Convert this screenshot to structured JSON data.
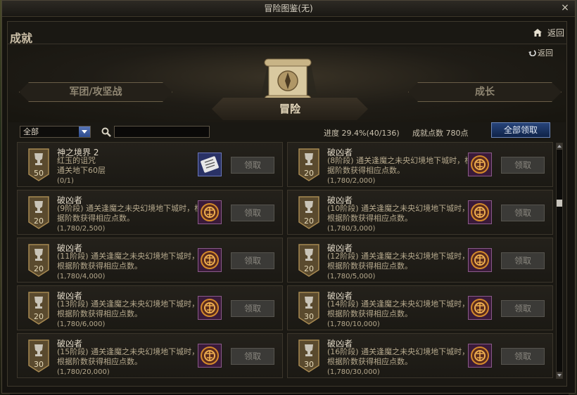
{
  "window": {
    "title": "冒险图鉴(无)",
    "close_label": "×"
  },
  "header": {
    "section_title": "成就",
    "return_label": "返回"
  },
  "sub_return": {
    "label": "返回"
  },
  "tabs": {
    "left": "军团/攻坚战",
    "center": "冒险",
    "right": "成长"
  },
  "filter": {
    "selected": "全部",
    "search_placeholder": ""
  },
  "stats": {
    "progress": "进度 29.4%(40/136)",
    "points": "成就点数 780点"
  },
  "claim_all_label": "全部领取",
  "claim_label": "领取",
  "achievements": [
    {
      "title": "神之境界 2",
      "desc": "红玉的诅咒\n通关地下60层",
      "progress": "(0/1)",
      "points": "50",
      "reward_icon": "scroll-ticket-icon"
    },
    {
      "title": "破凶者",
      "desc": "(8阶段) 通关逢魔之未央幻境地下城时，根据阶数获得相应点数。",
      "progress": "(1,780/2,000)",
      "points": "20",
      "reward_icon": "emblem-icon"
    },
    {
      "title": "破凶者",
      "desc": "(9阶段) 通关逢魔之未央幻境地下城时，根据阶数获得相应点数。",
      "progress": "(1,780/2,500)",
      "points": "20",
      "reward_icon": "emblem-icon"
    },
    {
      "title": "破凶者",
      "desc": "(10阶段) 通关逢魔之未央幻境地下城时，根据阶数获得相应点数。",
      "progress": "(1,780/3,000)",
      "points": "20",
      "reward_icon": "emblem-icon"
    },
    {
      "title": "破凶者",
      "desc": "(11阶段) 通关逢魔之未央幻境地下城时，根据阶数获得相应点数。",
      "progress": "(1,780/4,000)",
      "points": "20",
      "reward_icon": "emblem-icon"
    },
    {
      "title": "破凶者",
      "desc": "(12阶段) 通关逢魔之未央幻境地下城时，根据阶数获得相应点数。",
      "progress": "(1,780/5,000)",
      "points": "20",
      "reward_icon": "emblem-icon"
    },
    {
      "title": "破凶者",
      "desc": "(13阶段) 通关逢魔之未央幻境地下城时，根据阶数获得相应点数。",
      "progress": "(1,780/6,000)",
      "points": "20",
      "reward_icon": "emblem-icon"
    },
    {
      "title": "破凶者",
      "desc": "(14阶段) 通关逢魔之未央幻境地下城时，根据阶数获得相应点数。",
      "progress": "(1,780/10,000)",
      "points": "30",
      "reward_icon": "emblem-icon"
    },
    {
      "title": "破凶者",
      "desc": "(15阶段) 通关逢魔之未央幻境地下城时，根据阶数获得相应点数。",
      "progress": "(1,780/20,000)",
      "points": "30",
      "reward_icon": "emblem-icon"
    },
    {
      "title": "破凶者",
      "desc": "(16阶段) 通关逢魔之未央幻境地下城时，根据阶数获得相应点数。",
      "progress": "(1,780/30,000)",
      "points": "30",
      "reward_icon": "emblem-icon"
    }
  ],
  "colors": {
    "panel_bg": "#1a1813",
    "claim_all_blue": "#27447a",
    "badge_gold": "#c9a86a",
    "emblem_orange": "#d48a2a"
  }
}
